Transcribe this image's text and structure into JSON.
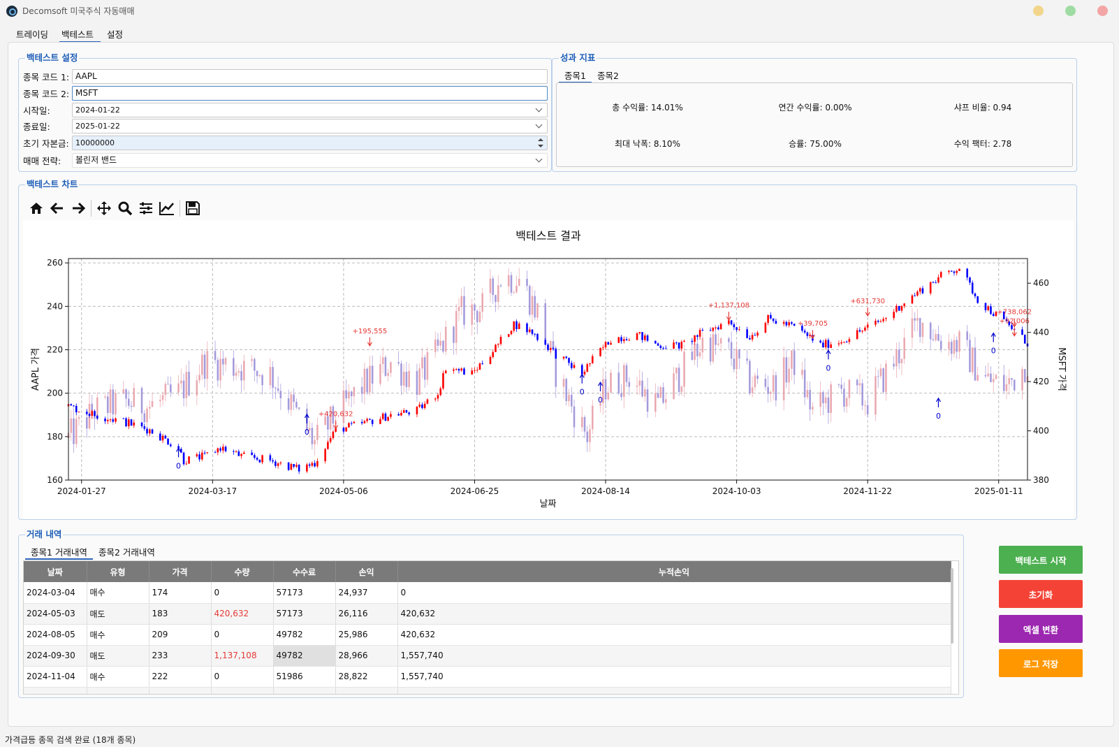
{
  "app": {
    "title": "Decomsoft 미국주식 자동매매"
  },
  "main_tabs": [
    "트레이딩",
    "백테스트",
    "설정"
  ],
  "backtest_settings": {
    "title": "백테스트 설정",
    "stock1_label": "종목 코드 1:",
    "stock1_value": "AAPL",
    "stock2_label": "종목 코드 2:",
    "stock2_value": "MSFT",
    "start_label": "시작일:",
    "start_value": "2024-01-22",
    "end_label": "종료일:",
    "end_value": "2025-01-22",
    "capital_label": "초기 자본금:",
    "capital_value": "10000000",
    "strategy_label": "매매 전략:",
    "strategy_value": "볼린저 밴드"
  },
  "performance": {
    "title": "성과 지표",
    "tabs": [
      "종목1",
      "종목2"
    ],
    "total_return": "총 수익률: 14.01%",
    "annual_return": "연간 수익률: 0.00%",
    "sharpe": "샤프 비율: 0.94",
    "max_drawdown": "최대 낙폭: 8.10%",
    "win_rate": "승률: 75.00%",
    "profit_factor": "수익 팩터: 2.78"
  },
  "chart_panel": {
    "title": "백테스트 차트"
  },
  "toolbar_icons": [
    "home-icon",
    "back-arrow-icon",
    "forward-arrow-icon",
    "pan-icon",
    "zoom-icon",
    "configure-subplots-icon",
    "edit-axis-icon",
    "save-icon"
  ],
  "chart_data": {
    "type": "candlestick",
    "title": "백테스트 결과",
    "xlabel": "날짜",
    "ylabel_left": "AAPL 가격",
    "ylabel_right": "MSFT 가격",
    "ylim_left": [
      160,
      262
    ],
    "ylim_right": [
      380,
      470
    ],
    "xlim": [
      "2024-01-22",
      "2025-01-22"
    ],
    "yticks_left": [
      160,
      180,
      200,
      220,
      240,
      260
    ],
    "yticks_right": [
      380,
      400,
      420,
      440,
      460
    ],
    "xticks": [
      "2024-01-27",
      "2024-03-17",
      "2024-05-06",
      "2024-06-25",
      "2024-08-14",
      "2024-10-03",
      "2024-11-22",
      "2025-01-11"
    ],
    "grid": true,
    "colors": {
      "aapl_up": "#ff0000",
      "aapl_down": "#0000ff",
      "msft_up": "#e8a0a8",
      "msft_down": "#9a8fd8",
      "buy": "#0000cc",
      "sell": "#e53935"
    },
    "aapl_path": [
      [
        "2024-01-22",
        194
      ],
      [
        "2024-02-01",
        190
      ],
      [
        "2024-02-12",
        187
      ],
      [
        "2024-02-22",
        183
      ],
      [
        "2024-03-04",
        175
      ],
      [
        "2024-03-06",
        169
      ],
      [
        "2024-03-14",
        171
      ],
      [
        "2024-03-20",
        175
      ],
      [
        "2024-03-28",
        171
      ],
      [
        "2024-04-08",
        169
      ],
      [
        "2024-04-19",
        165
      ],
      [
        "2024-04-25",
        168
      ],
      [
        "2024-05-03",
        183
      ],
      [
        "2024-05-13",
        186
      ],
      [
        "2024-05-24",
        190
      ],
      [
        "2024-06-03",
        192
      ],
      [
        "2024-06-11",
        200
      ],
      [
        "2024-06-14",
        212
      ],
      [
        "2024-06-24",
        209
      ],
      [
        "2024-07-03",
        221
      ],
      [
        "2024-07-10",
        232
      ],
      [
        "2024-07-17",
        228
      ],
      [
        "2024-07-26",
        218
      ],
      [
        "2024-08-05",
        209
      ],
      [
        "2024-08-08",
        214
      ],
      [
        "2024-08-16",
        225
      ],
      [
        "2024-08-26",
        227
      ],
      [
        "2024-09-03",
        222
      ],
      [
        "2024-09-12",
        222
      ],
      [
        "2024-09-20",
        228
      ],
      [
        "2024-09-30",
        233
      ],
      [
        "2024-10-08",
        226
      ],
      [
        "2024-10-15",
        234
      ],
      [
        "2024-10-24",
        231
      ],
      [
        "2024-11-01",
        225
      ],
      [
        "2024-11-04",
        222
      ],
      [
        "2024-11-12",
        224
      ],
      [
        "2024-11-20",
        229
      ],
      [
        "2024-11-28",
        234
      ],
      [
        "2024-12-06",
        242
      ],
      [
        "2024-12-13",
        248
      ],
      [
        "2024-12-20",
        254
      ],
      [
        "2024-12-27",
        258
      ],
      [
        "2025-01-03",
        243
      ],
      [
        "2025-01-10",
        236
      ],
      [
        "2025-01-17",
        229
      ],
      [
        "2025-01-22",
        223
      ]
    ],
    "msft_path": [
      [
        "2024-01-22",
        397
      ],
      [
        "2024-02-01",
        408
      ],
      [
        "2024-02-12",
        412
      ],
      [
        "2024-02-22",
        410
      ],
      [
        "2024-03-04",
        415
      ],
      [
        "2024-03-14",
        428
      ],
      [
        "2024-03-22",
        427
      ],
      [
        "2024-04-01",
        425
      ],
      [
        "2024-04-08",
        423
      ],
      [
        "2024-04-15",
        412
      ],
      [
        "2024-04-25",
        395
      ],
      [
        "2024-05-03",
        406
      ],
      [
        "2024-05-13",
        418
      ],
      [
        "2024-05-24",
        428
      ],
      [
        "2024-06-03",
        420
      ],
      [
        "2024-06-11",
        432
      ],
      [
        "2024-06-20",
        448
      ],
      [
        "2024-06-28",
        450
      ],
      [
        "2024-07-05",
        462
      ],
      [
        "2024-07-12",
        462
      ],
      [
        "2024-07-19",
        448
      ],
      [
        "2024-07-26",
        424
      ],
      [
        "2024-08-02",
        408
      ],
      [
        "2024-08-07",
        398
      ],
      [
        "2024-08-14",
        418
      ],
      [
        "2024-08-23",
        422
      ],
      [
        "2024-09-03",
        410
      ],
      [
        "2024-09-12",
        424
      ],
      [
        "2024-09-20",
        436
      ],
      [
        "2024-09-30",
        432
      ],
      [
        "2024-10-08",
        420
      ],
      [
        "2024-10-17",
        418
      ],
      [
        "2024-10-25",
        428
      ],
      [
        "2024-11-01",
        408
      ],
      [
        "2024-11-12",
        416
      ],
      [
        "2024-11-22",
        412
      ],
      [
        "2024-12-02",
        428
      ],
      [
        "2024-12-12",
        445
      ],
      [
        "2024-12-20",
        437
      ],
      [
        "2024-12-27",
        435
      ],
      [
        "2025-01-06",
        421
      ],
      [
        "2025-01-14",
        418
      ],
      [
        "2025-01-22",
        428
      ]
    ],
    "signals": [
      {
        "series": "AAPL",
        "date": "2024-03-04",
        "price": 175,
        "type": "buy",
        "label": "0"
      },
      {
        "series": "MSFT",
        "date": "2024-04-22",
        "price": 407,
        "type": "buy",
        "label": "0"
      },
      {
        "series": "AAPL",
        "date": "2024-05-03",
        "price": 183,
        "type": "sell",
        "label": "+420,632"
      },
      {
        "series": "MSFT",
        "date": "2024-05-16",
        "price": 434,
        "type": "sell",
        "label": "+195,555"
      },
      {
        "series": "AAPL",
        "date": "2024-08-05",
        "price": 209,
        "type": "buy",
        "label": "0"
      },
      {
        "series": "MSFT",
        "date": "2024-08-12",
        "price": 420,
        "type": "buy",
        "label": "0"
      },
      {
        "series": "AAPL",
        "date": "2024-09-30",
        "price": 233,
        "type": "sell",
        "label": "+1,137,108"
      },
      {
        "series": "MSFT",
        "date": "2024-11-01",
        "price": 437,
        "type": "sell",
        "label": "+39,705"
      },
      {
        "series": "MSFT",
        "date": "2024-11-07",
        "price": 433,
        "type": "buy",
        "label": "0"
      },
      {
        "series": "AAPL",
        "date": "2024-11-22",
        "price": 235,
        "type": "sell",
        "label": "+631,730"
      },
      {
        "series": "AAPL",
        "date": "2024-12-19",
        "price": 198,
        "type": "buy",
        "label": "0"
      },
      {
        "series": "MSFT",
        "date": "2025-01-09",
        "price": 440,
        "type": "buy",
        "label": "0"
      },
      {
        "series": "AAPL",
        "date": "2025-01-17",
        "price": 230,
        "type": "sell",
        "label": "+738,062"
      },
      {
        "series": "MSFT",
        "date": "2025-01-17",
        "price": 438,
        "type": "sell",
        "label": "+92,006"
      }
    ]
  },
  "trades": {
    "title": "거래 내역",
    "tabs": [
      "종목1 거래내역",
      "종목2 거래내역"
    ],
    "columns": [
      "날짜",
      "유형",
      "가격",
      "수량",
      "수수료",
      "손익",
      "누적손익"
    ],
    "rows": [
      [
        "2024-03-04",
        "매수",
        "174",
        "0",
        "57173",
        "24,937",
        "0"
      ],
      [
        "2024-05-03",
        "매도",
        "183",
        "420,632",
        "57173",
        "26,116",
        "420,632"
      ],
      [
        "2024-08-05",
        "매수",
        "209",
        "0",
        "49782",
        "25,986",
        "420,632"
      ],
      [
        "2024-09-30",
        "매도",
        "233",
        "1,137,108",
        "49782",
        "28,966",
        "1,557,740"
      ],
      [
        "2024-11-04",
        "매수",
        "222",
        "0",
        "51986",
        "28,822",
        "1,557,740"
      ],
      [
        "",
        "",
        "",
        "",
        "",
        "",
        ""
      ]
    ]
  },
  "actions": {
    "start": "백테스트 시작",
    "reset": "초기화",
    "excel": "엑셀 변환",
    "save_log": "로그 저장",
    "colors": {
      "start": "#4caf50",
      "reset": "#f44336",
      "excel": "#9c27b0",
      "save_log": "#ff9800"
    }
  },
  "status": "가격급등 종목 검색 완료 (18개 종목)"
}
